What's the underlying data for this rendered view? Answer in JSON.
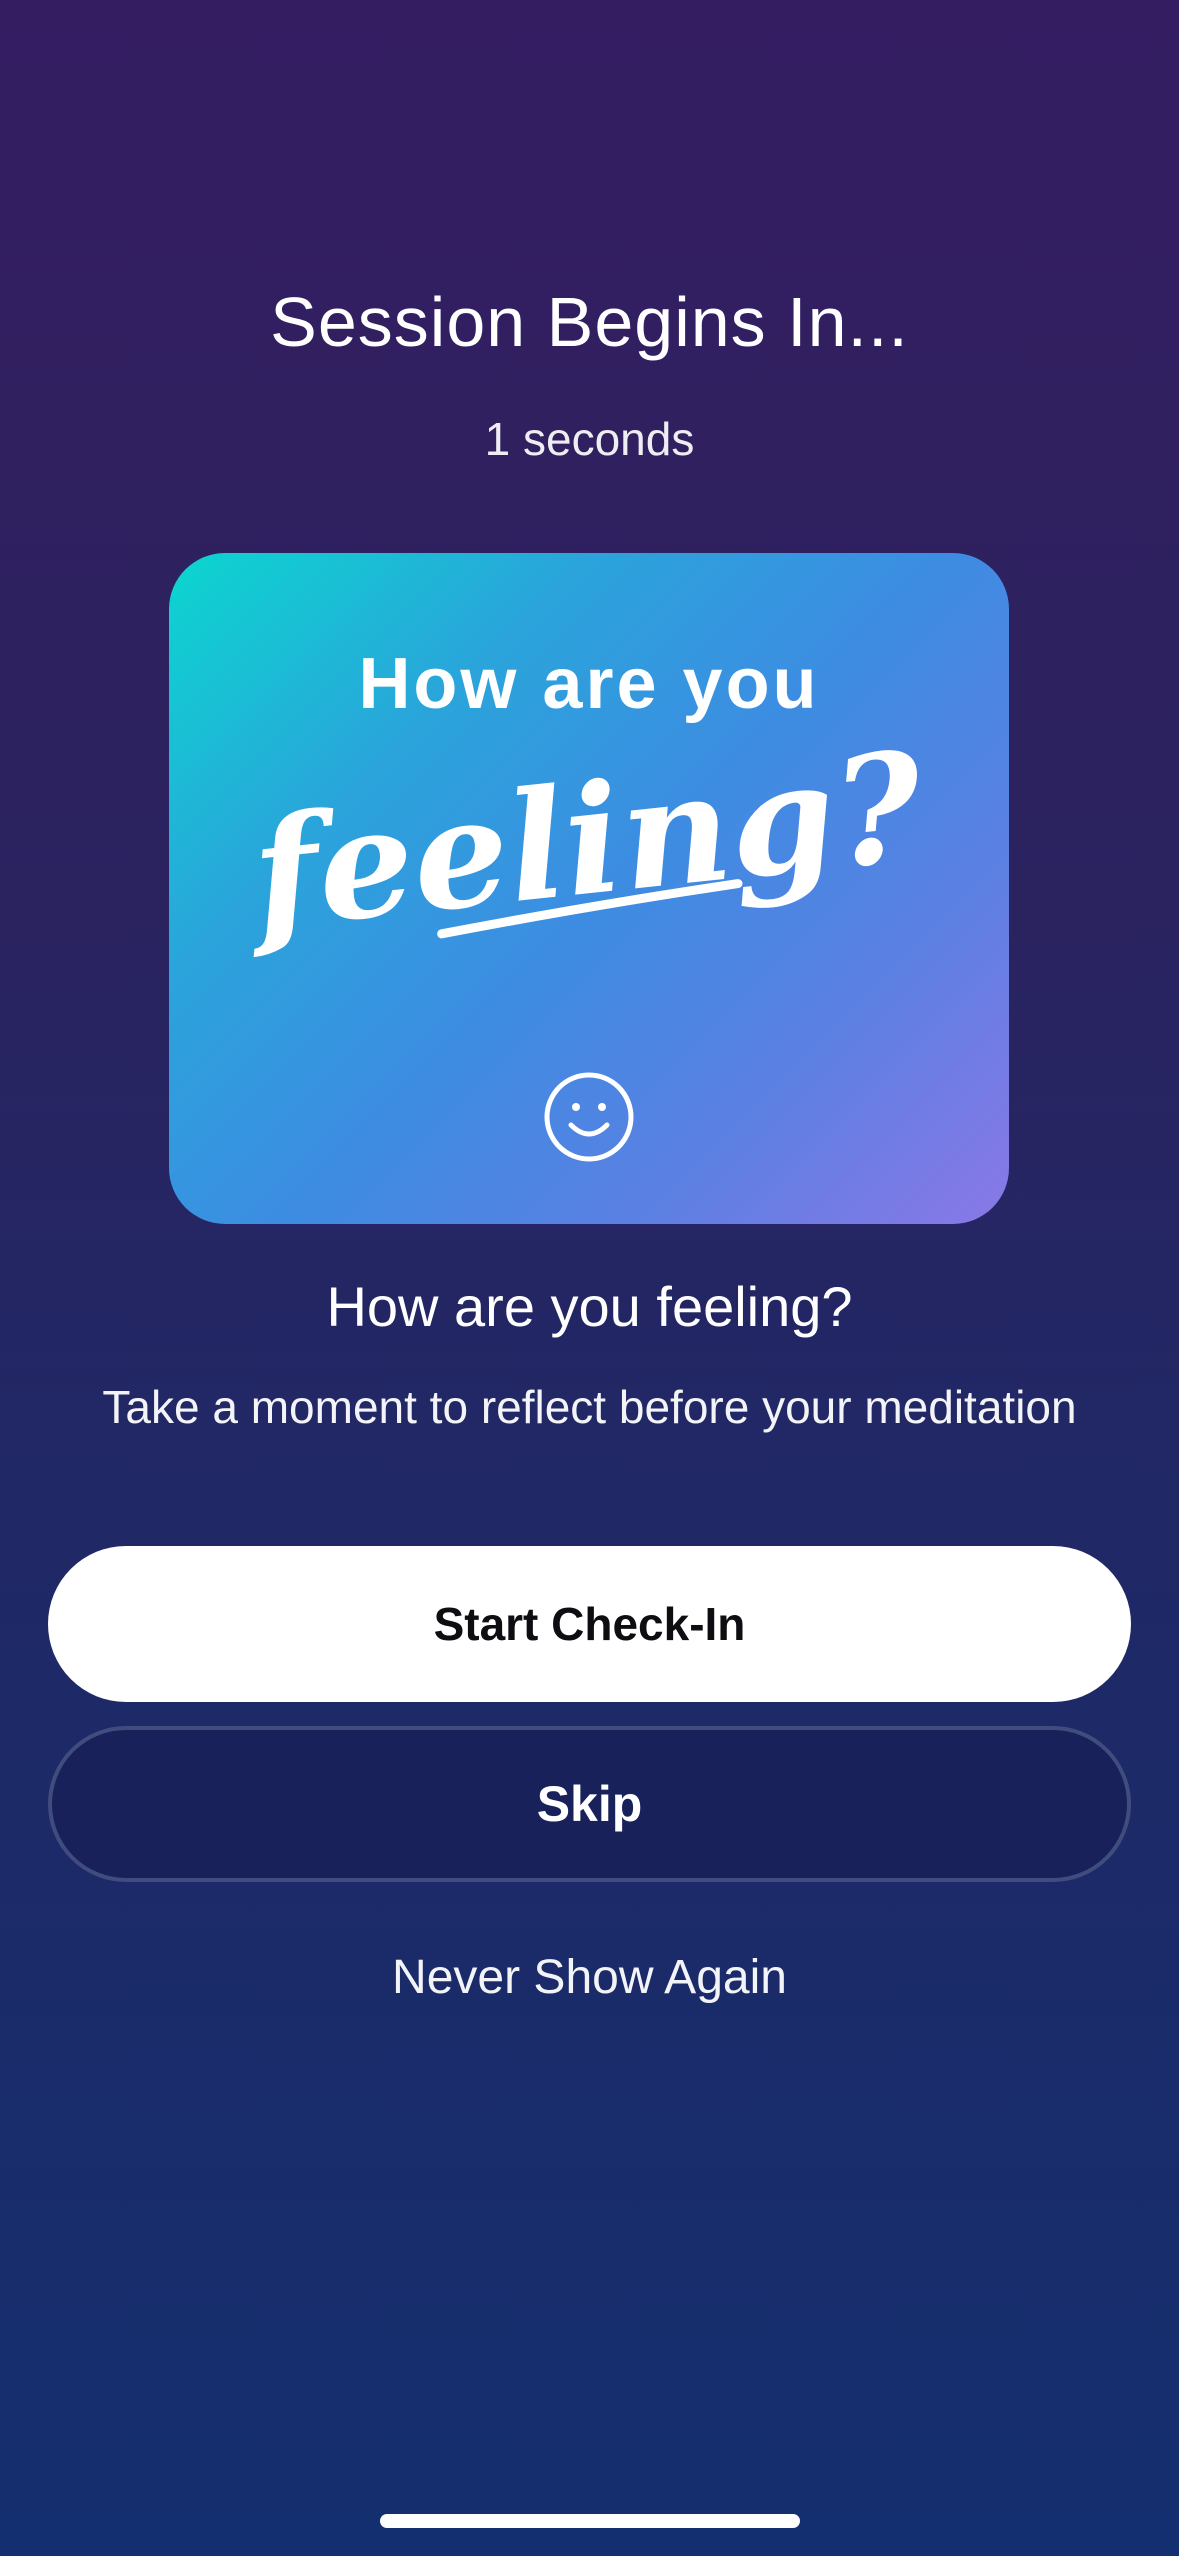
{
  "header": {
    "title": "Session Begins In...",
    "countdown": "1 seconds"
  },
  "card": {
    "line1": "How are you",
    "script_word": "feeling?",
    "icon": "smiley-face-icon"
  },
  "prompt": {
    "title": "How are you feeling?",
    "description": "Take a moment to reflect before your meditation"
  },
  "actions": {
    "start_label": "Start Check-In",
    "skip_label": "Skip",
    "never_show_label": "Never Show Again"
  },
  "colors": {
    "background_top": "#351d62",
    "background_bottom": "#142f6f",
    "card_gradient_start": "#0bd6cf",
    "card_gradient_end": "#8a78e6",
    "skip_button_bg": "#18215a"
  }
}
